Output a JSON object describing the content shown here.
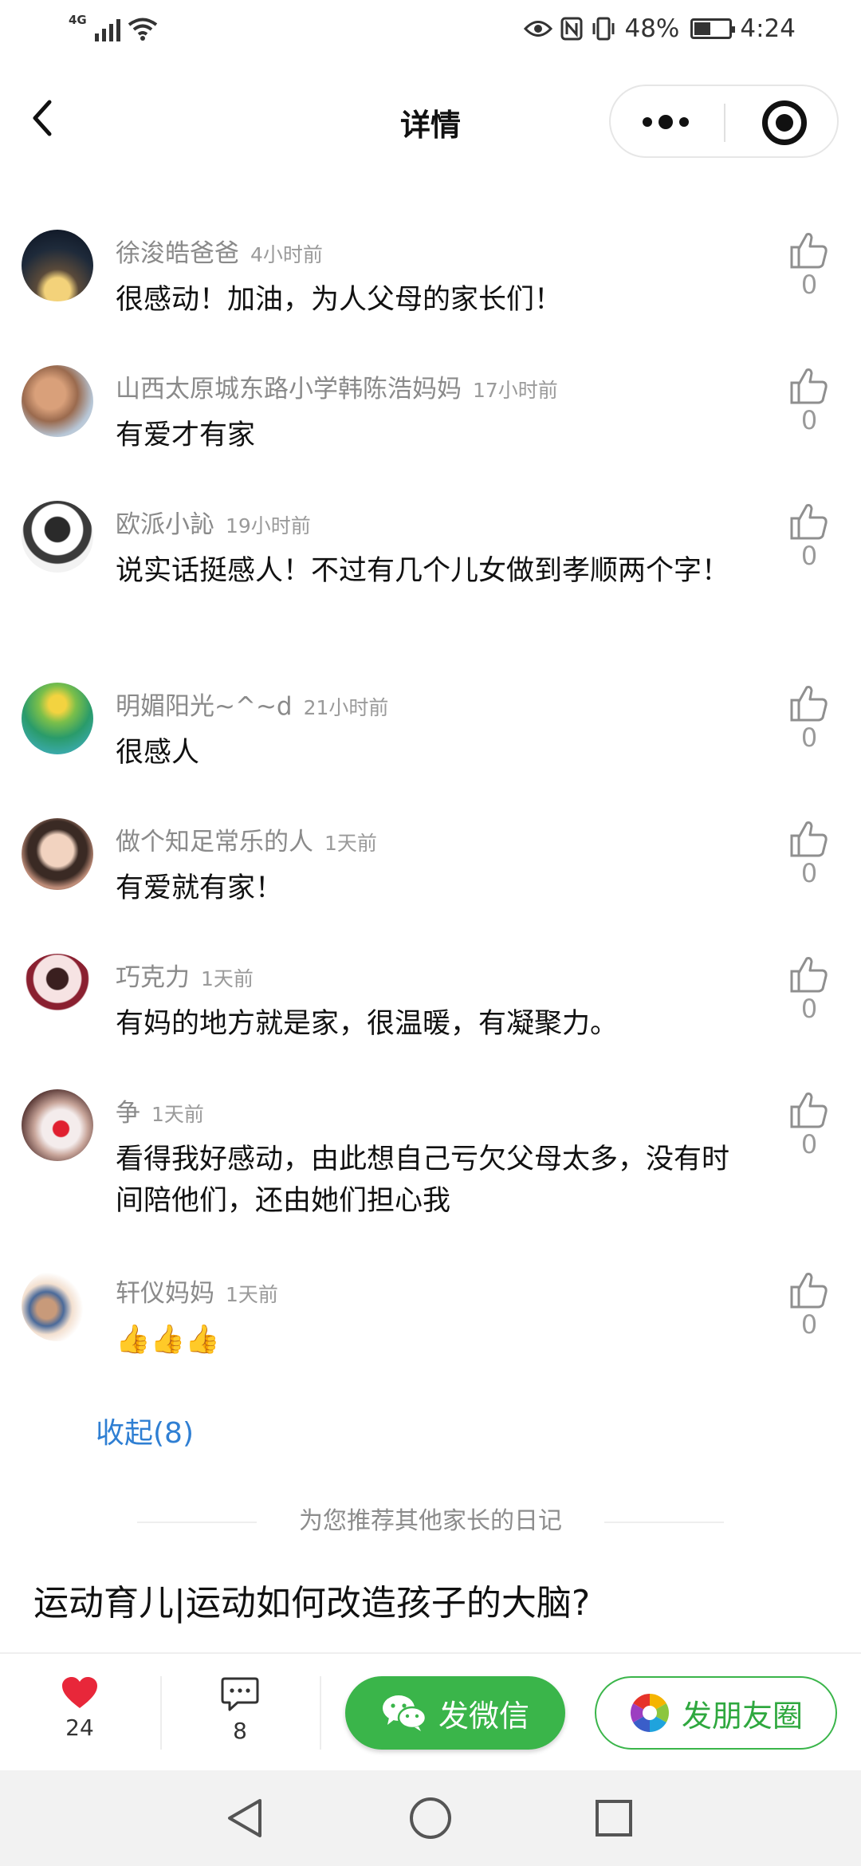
{
  "status_bar": {
    "network_label": "4G",
    "battery_percent": "48%",
    "battery_level": 0.48,
    "time": "4:24",
    "icons": [
      "signal-icon",
      "wifi-icon",
      "eye-icon",
      "nfc-icon",
      "vibrate-icon",
      "battery-icon"
    ]
  },
  "nav": {
    "title": "详情",
    "back_icon": "chevron-left-icon",
    "more_icon": "more-dots-icon",
    "close_icon": "target-close-icon"
  },
  "comments": [
    {
      "name": "徐浚皓爸爸",
      "time": "4小时前",
      "text": "很感动！加油，为人父母的家长们！",
      "likes": "0"
    },
    {
      "name": "山西太原城东路小学韩陈浩妈妈",
      "time": "17小时前",
      "text": "有爱才有家",
      "likes": "0"
    },
    {
      "name": "欧派小訫",
      "time": "19小时前",
      "text": "说实话挺感人！不过有几个儿女做到孝顺两个字！",
      "likes": "0"
    },
    {
      "name": "明媚阳光~^~d",
      "time": "21小时前",
      "text": "很感人",
      "likes": "0"
    },
    {
      "name": "做个知足常乐的人",
      "time": "1天前",
      "text": "有爱就有家！",
      "likes": "0"
    },
    {
      "name": "巧克力",
      "time": "1天前",
      "text": "有妈的地方就是家，很温暖，有凝聚力。",
      "likes": "0"
    },
    {
      "name": "争",
      "time": "1天前",
      "text": "看得我好感动，由此想自己亏欠父母太多，没有时间陪他们，还由她们担心我",
      "likes": "0"
    },
    {
      "name": "轩仪妈妈",
      "time": "1天前",
      "text": "👍👍👍",
      "likes": "0"
    }
  ],
  "collapse_label": "收起(8)",
  "recommend_label": "为您推荐其他家长的日记",
  "article_title": "运动育儿|运动如何改造孩子的大脑?",
  "bottom_bar": {
    "likes_count": "24",
    "comments_count": "8",
    "wechat_label": "发微信",
    "moments_label": "发朋友圈",
    "accent_color": "#3ab54a",
    "heart_color": "#e8273a"
  },
  "system_nav": [
    "back-triangle-icon",
    "home-circle-icon",
    "recents-square-icon"
  ]
}
